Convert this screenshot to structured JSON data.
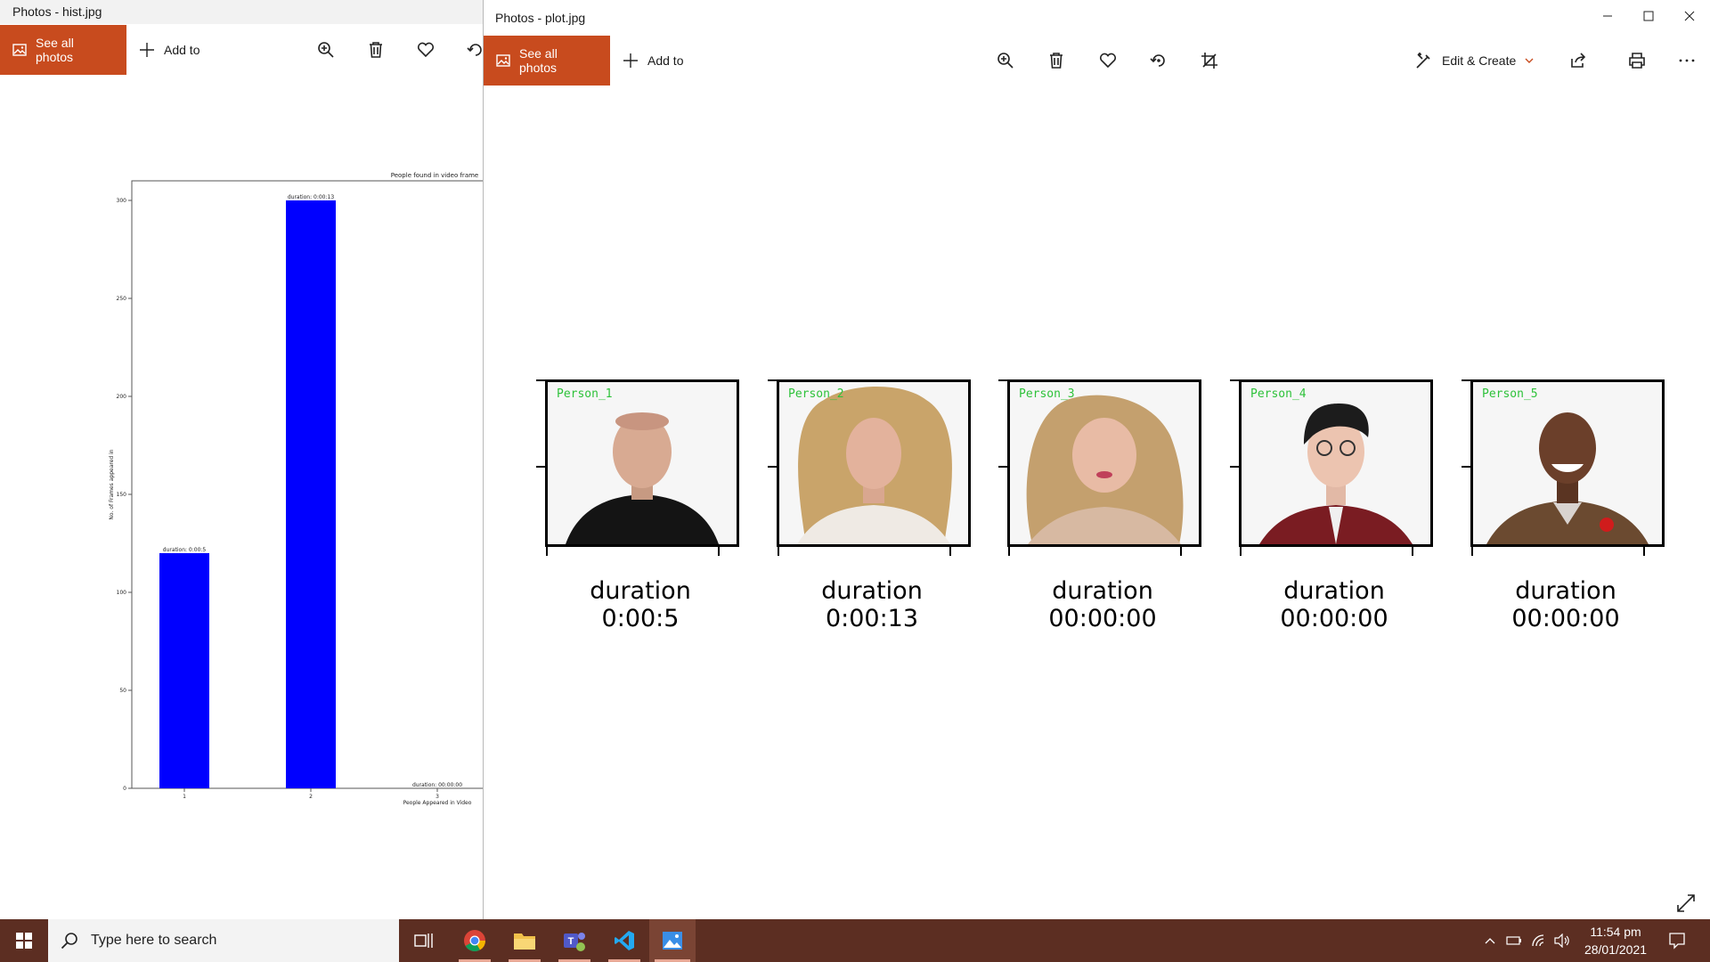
{
  "left_window": {
    "title": "Photos - hist.jpg",
    "see_all_label": "See all photos",
    "add_to_label": "Add to"
  },
  "right_window": {
    "title": "Photos - plot.jpg",
    "see_all_label": "See all photos",
    "add_to_label": "Add to",
    "edit_create_label": "Edit & Create"
  },
  "chart_data": {
    "type": "bar",
    "title": "People found in video frame",
    "xlabel": "People Appeared in Video",
    "ylabel": "No. of Frames appeared in",
    "categories": [
      "1",
      "2",
      "3"
    ],
    "values": [
      120,
      300,
      0
    ],
    "bar_labels": [
      "duration: 0:00:5",
      "duration: 0:00:13",
      "duration: 00:00:00"
    ],
    "ylim": [
      0,
      310
    ],
    "yticks": [
      0,
      50,
      100,
      150,
      200,
      250,
      300
    ],
    "bar_color": "#0000ff"
  },
  "persons": [
    {
      "label": "Person_1",
      "caption_line1": "duration",
      "caption_line2": "0:00:5"
    },
    {
      "label": "Person_2",
      "caption_line1": "duration",
      "caption_line2": "0:00:13"
    },
    {
      "label": "Person_3",
      "caption_line1": "duration",
      "caption_line2": "00:00:00"
    },
    {
      "label": "Person_4",
      "caption_line1": "duration",
      "caption_line2": "00:00:00"
    },
    {
      "label": "Person_5",
      "caption_line1": "duration",
      "caption_line2": "00:00:00"
    }
  ],
  "taskbar": {
    "search_placeholder": "Type here to search",
    "time": "11:54 pm",
    "date": "28/01/2021"
  },
  "colors": {
    "accent": "#c84b1e",
    "taskbar": "#5c2e22",
    "person_label": "#2ec23a"
  }
}
